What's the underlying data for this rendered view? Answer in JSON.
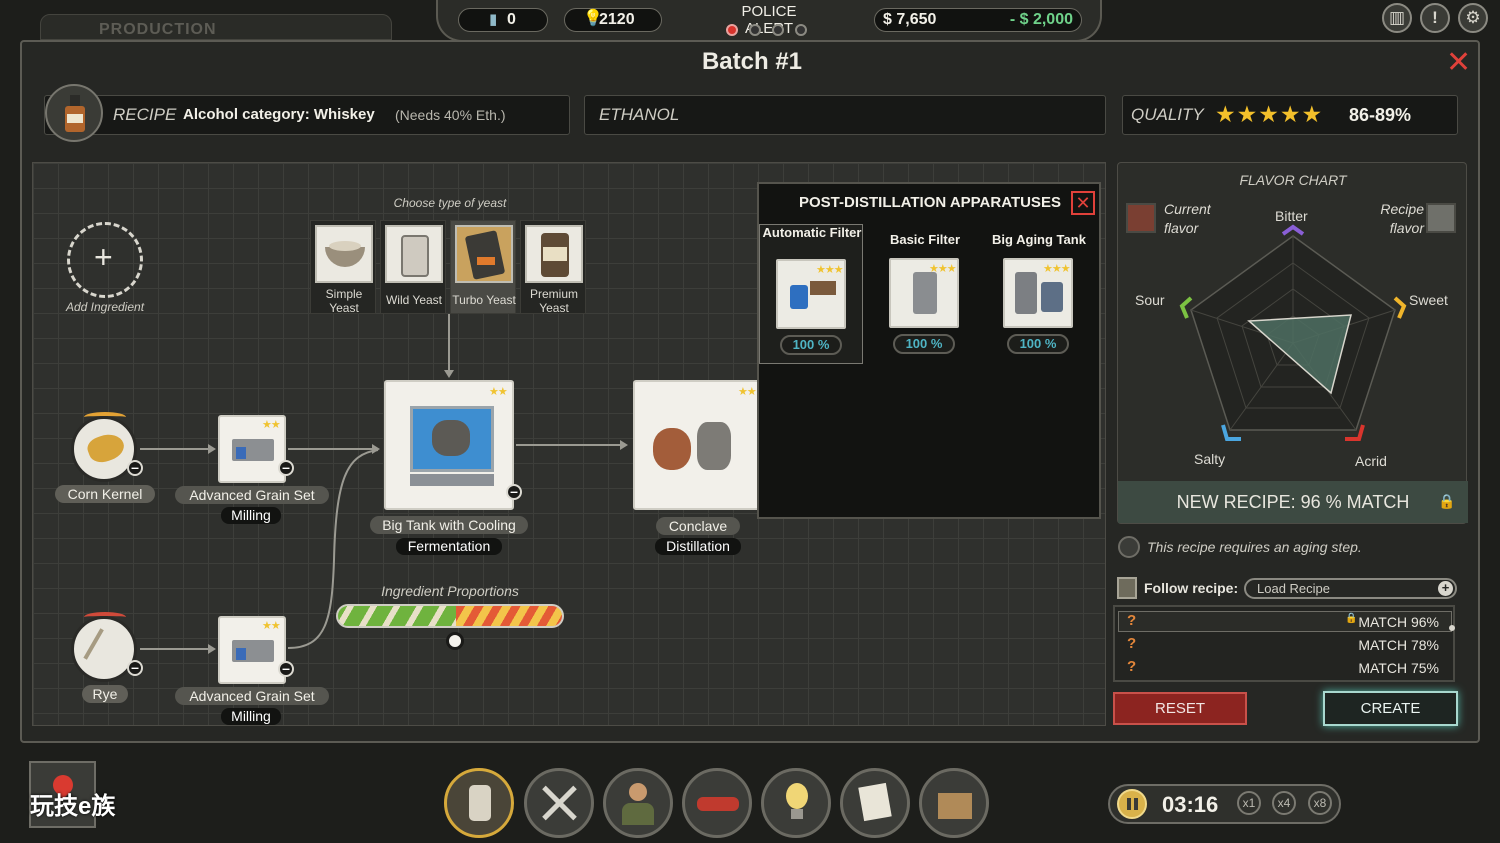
{
  "topbar": {
    "left_tab": "PRODUCTION",
    "bottles": "0",
    "ideas": "2120",
    "police_alert": "POLICE ALERT",
    "money": "$ 7,650",
    "expense": "- $ 2,000"
  },
  "window": {
    "title": "Batch #1"
  },
  "header": {
    "recipe_label": "RECIPE",
    "category": "Alcohol category: Whiskey",
    "needs": "(Needs 40% Eth.)",
    "ethanol_label": "ETHANOL",
    "quality_label": "QUALITY",
    "quality_stars": "★★★★★",
    "quality_value": "86-89%"
  },
  "pipeline": {
    "add_ingredient": "Add Ingredient",
    "choose_yeast": "Choose type of yeast",
    "yeasts": [
      {
        "name": "Simple Yeast"
      },
      {
        "name": "Wild Yeast"
      },
      {
        "name": "Turbo Yeast"
      },
      {
        "name": "Premium Yeast"
      }
    ],
    "ingredient1": "Corn Kernel",
    "ingredient2": "Rye",
    "grain_set1": "Advanced Grain Set",
    "grain_stage1": "Milling",
    "grain_set2": "Advanced Grain Set",
    "grain_stage2": "Milling",
    "tank": "Big Tank with Cooling",
    "tank_stage": "Fermentation",
    "still": "Conclave",
    "still_stage": "Distillation",
    "proportions_label": "Ingredient Proportions",
    "stars2": "★★",
    "stars3": "★★★"
  },
  "popup": {
    "title": "POST-DISTILLATION APPARATUSES",
    "items": [
      {
        "name": "Automatic Filter",
        "pct": "100 %"
      },
      {
        "name": "Basic Filter",
        "pct": "100 %"
      },
      {
        "name": "Big Aging Tank",
        "pct": "100 %"
      }
    ]
  },
  "flavor": {
    "title": "FLAVOR CHART",
    "current": "Current flavor",
    "recipe": "Recipe flavor",
    "axes": {
      "bitter": "Bitter",
      "sweet": "Sweet",
      "acrid": "Acrid",
      "salty": "Salty",
      "sour": "Sour"
    },
    "new_recipe": "NEW RECIPE: 96 % MATCH",
    "current_color": "#7a3f32",
    "recipe_color": "#6f706a"
  },
  "recipe_panel": {
    "aging_note": "This recipe requires an aging step.",
    "follow_label": "Follow recipe:",
    "load_recipe": "Load Recipe",
    "matches": [
      "MATCH 96%",
      "MATCH 78%",
      "MATCH 75%"
    ],
    "reset": "RESET",
    "create": "CREATE"
  },
  "bottom": {
    "time": "03:16",
    "speeds": [
      "x1",
      "x4",
      "x8"
    ],
    "watermark": "玩技e族"
  }
}
